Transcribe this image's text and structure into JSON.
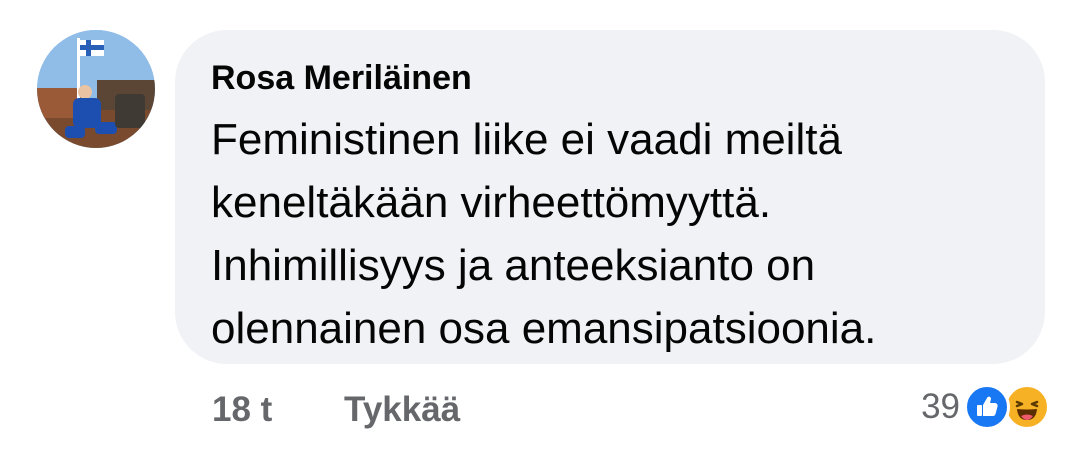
{
  "comment": {
    "author": "Rosa Meriläinen",
    "text": "Feministinen liike ei vaadi meiltä keneltäkään virheettömyyttä. Inhimillisyys ja anteeksianto on olennainen osa emansipatsioonia.",
    "time": "18 t",
    "like_label": "Tykkää",
    "reaction_count": "39",
    "reaction_icons": [
      "like-icon",
      "haha-icon"
    ],
    "colors": {
      "bubble": "#f0f2f5",
      "like_blue": "#1877f2",
      "haha_yellow": "#f7b125",
      "meta_gray": "#65676b"
    }
  }
}
